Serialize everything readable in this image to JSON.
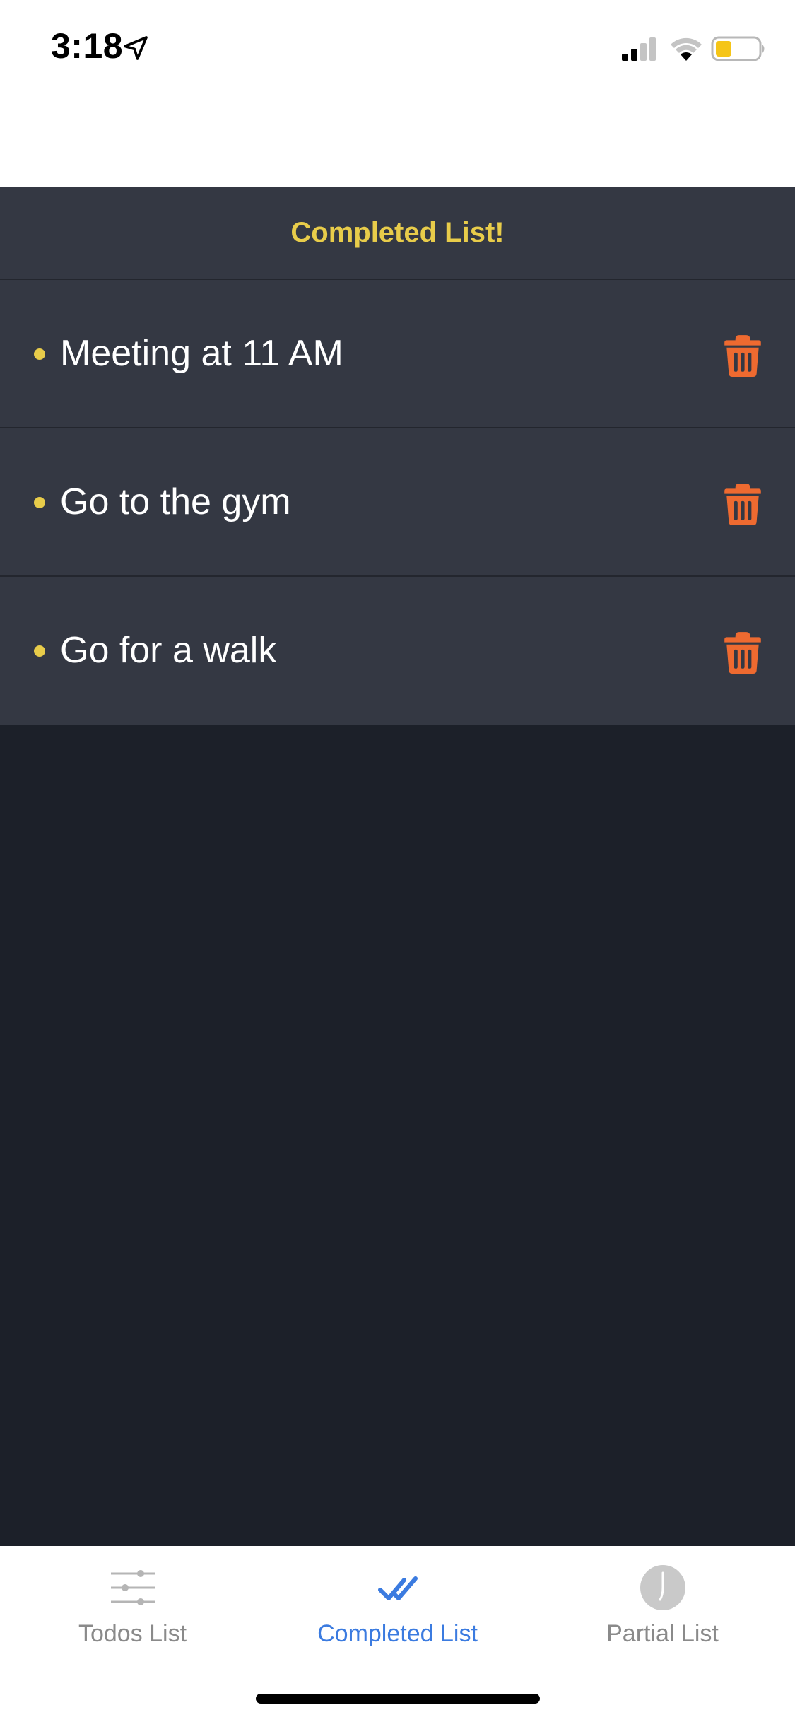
{
  "status_bar": {
    "time": "3:18"
  },
  "header": {
    "title": "Completed List!"
  },
  "list": {
    "items": [
      {
        "label": "Meeting at 11 AM"
      },
      {
        "label": "Go to the gym"
      },
      {
        "label": "Go for a walk"
      }
    ]
  },
  "tabs": [
    {
      "label": "Todos List",
      "icon": "sliders-icon",
      "active": false
    },
    {
      "label": "Completed List",
      "icon": "double-check-icon",
      "active": true
    },
    {
      "label": "Partial List",
      "icon": "clock-icon",
      "active": false
    }
  ],
  "colors": {
    "accent_yellow": "#e8cc4a",
    "delete_orange": "#ee6a30",
    "active_tab_blue": "#3b7be0",
    "list_bg": "#343843",
    "screen_bg": "#1c2029"
  }
}
